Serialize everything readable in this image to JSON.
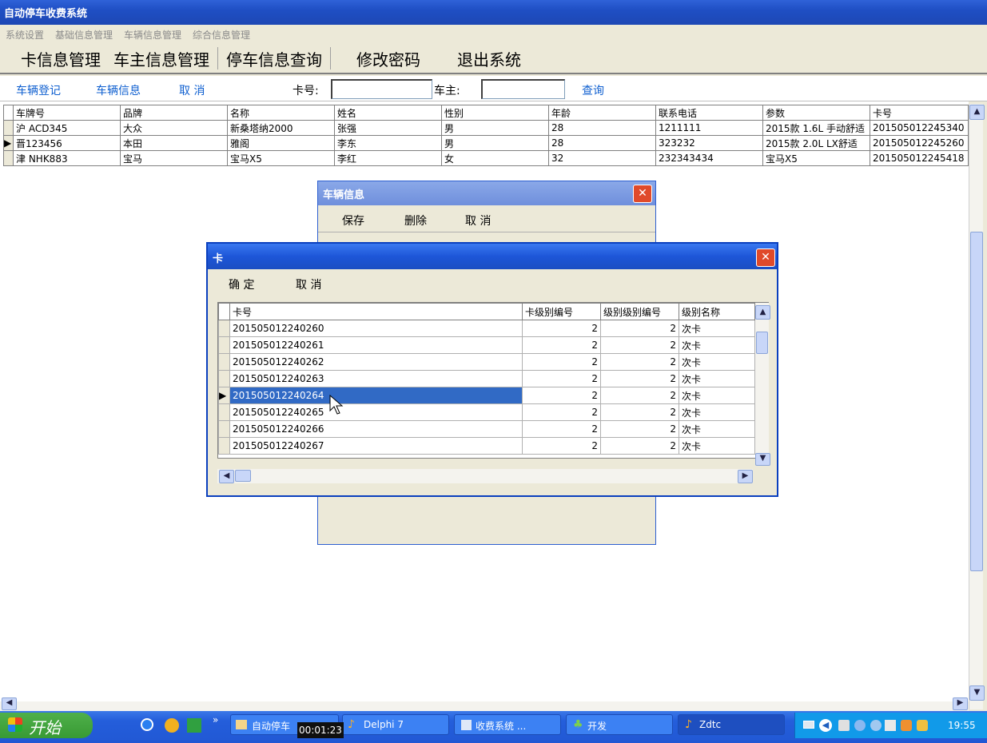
{
  "window": {
    "title": "自动停车收费系统"
  },
  "menu": [
    "系统设置",
    "基础信息管理",
    "车辆信息管理",
    "综合信息管理"
  ],
  "toolbar": [
    "卡信息管理",
    "车主信息管理",
    "停车信息查询",
    "修改密码",
    "退出系统"
  ],
  "subbar": {
    "register": "车辆登记",
    "vehicle_info": "车辆信息",
    "cancel": "取 消",
    "card_label": "卡号:",
    "owner_label": "车主:",
    "query": "查询"
  },
  "vehicle_table": {
    "columns": [
      "车牌号",
      "品牌",
      "名称",
      "姓名",
      "性别",
      "年龄",
      "联系电话",
      "参数",
      "卡号"
    ],
    "rows": [
      [
        "沪 ACD345",
        "大众",
        "新桑塔纳2000",
        "张强",
        "男",
        "28",
        "1211111",
        "2015款 1.6L 手动舒适",
        "201505012245340"
      ],
      [
        "晋123456",
        "本田",
        "雅阁",
        "李东",
        "男",
        "28",
        "323232",
        "2015款 2.0L LX舒适",
        "201505012245260"
      ],
      [
        "津 NHK883",
        "宝马",
        "宝马X5",
        "李红",
        "女",
        "32",
        "232343434",
        "宝马X5",
        "201505012245418"
      ]
    ],
    "selected_row": 1
  },
  "vehicle_dialog": {
    "title": "车辆信息",
    "buttons": [
      "保存",
      "删除",
      "取 消"
    ]
  },
  "card_dialog": {
    "title": "卡",
    "buttons": [
      "确 定",
      "取 消"
    ],
    "columns": [
      "卡号",
      "卡级别编号",
      "级别级别编号",
      "级别名称"
    ],
    "rows": [
      [
        "201505012240260",
        "2",
        "2",
        "次卡"
      ],
      [
        "201505012240261",
        "2",
        "2",
        "次卡"
      ],
      [
        "201505012240262",
        "2",
        "2",
        "次卡"
      ],
      [
        "201505012240263",
        "2",
        "2",
        "次卡"
      ],
      [
        "201505012240264",
        "2",
        "2",
        "次卡"
      ],
      [
        "201505012240265",
        "2",
        "2",
        "次卡"
      ],
      [
        "201505012240266",
        "2",
        "2",
        "次卡"
      ],
      [
        "201505012240267",
        "2",
        "2",
        "次卡"
      ]
    ],
    "selected_row": 4
  },
  "taskbar": {
    "start": "开始",
    "tasks": [
      "自动停车",
      "Delphi 7",
      "收费系统 ...",
      "开发",
      "Zdtc"
    ],
    "clock": "19:55",
    "recording_timer": "00:01:23"
  }
}
